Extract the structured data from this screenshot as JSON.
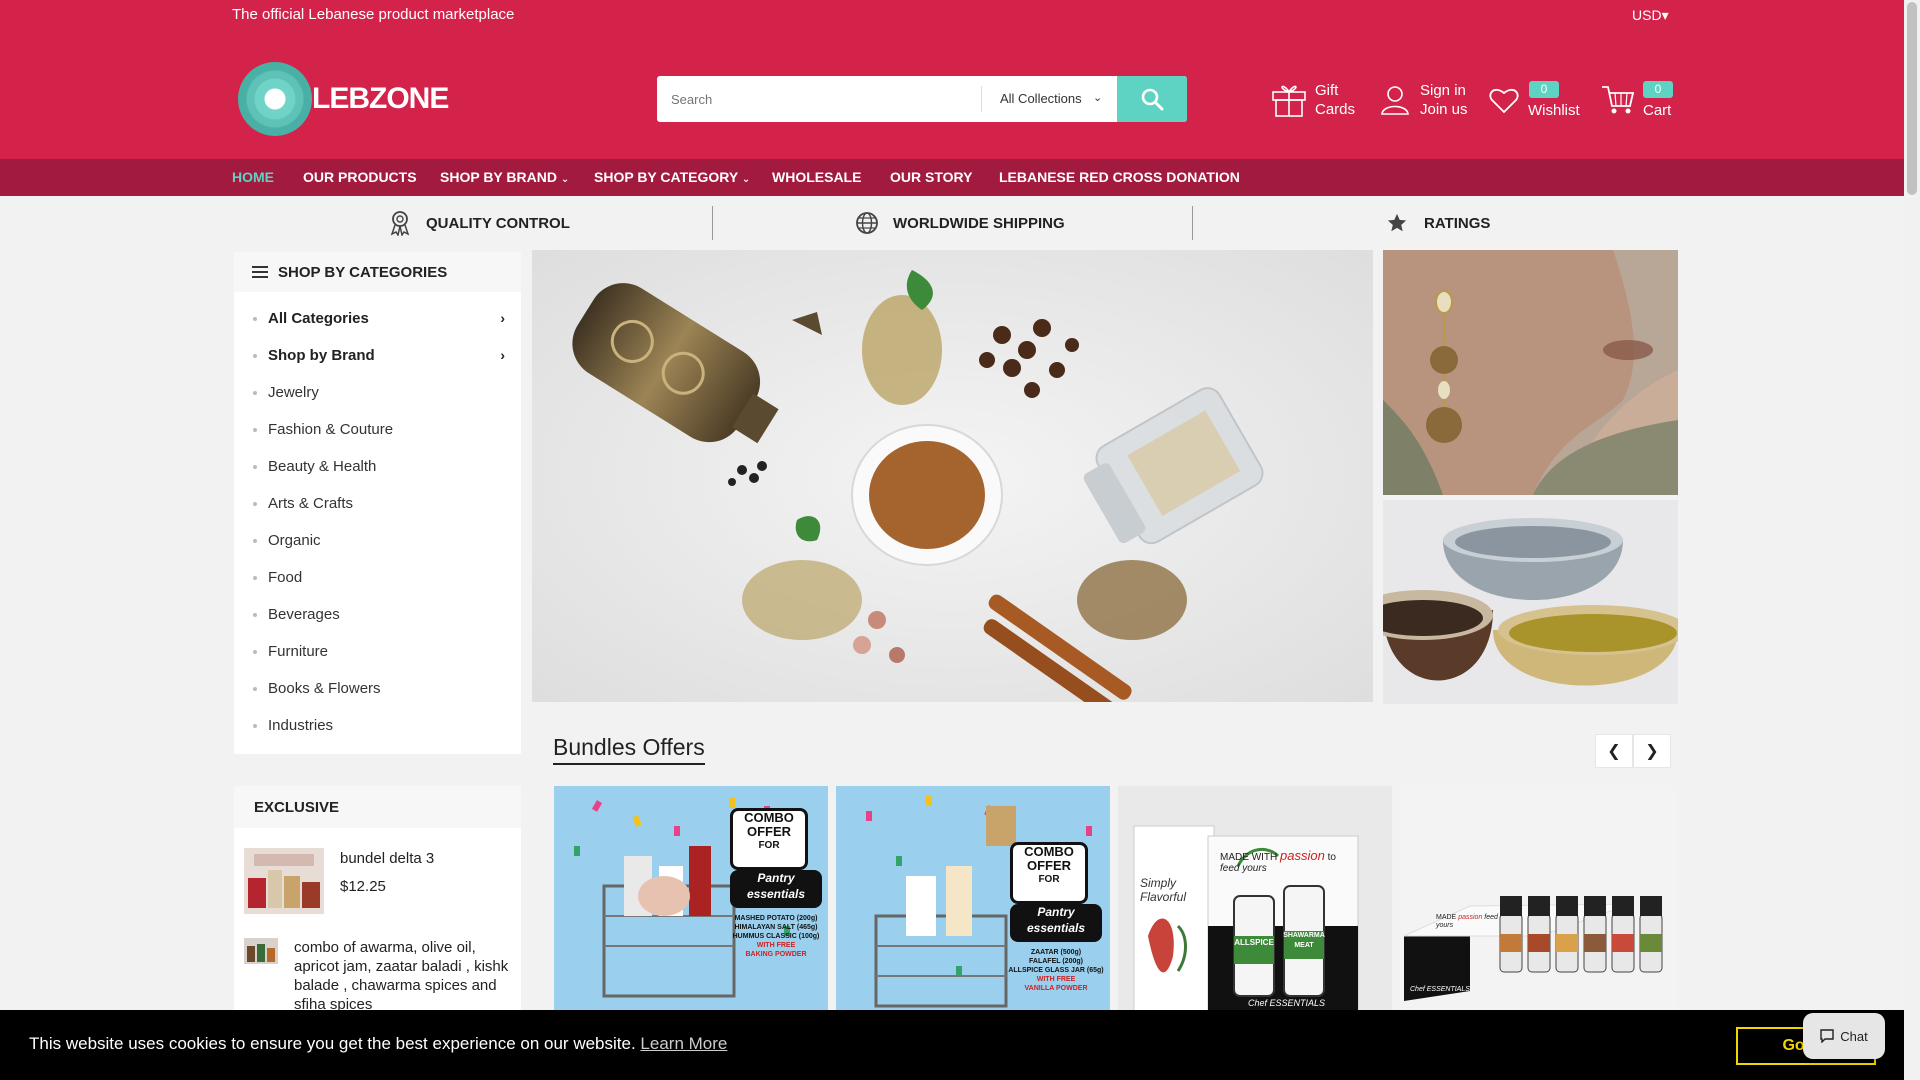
{
  "header": {
    "tagline": "The official Lebanese product marketplace",
    "currency": "USD",
    "logo_text": "LEBZONE",
    "search": {
      "placeholder": "Search",
      "collection": "All Collections"
    },
    "gift_cards": {
      "line1": "Gift",
      "line2": "Cards"
    },
    "account": {
      "line1": "Sign in",
      "line2": "Join us"
    },
    "wishlist": {
      "count": "0",
      "label": "Wishlist"
    },
    "cart": {
      "count": "0",
      "label": "Cart"
    },
    "accent_color": "#5fd3c3",
    "brand_color": "#d4234a"
  },
  "nav": {
    "items": [
      {
        "label": "HOME"
      },
      {
        "label": "OUR PRODUCTS"
      },
      {
        "label": "SHOP BY BRAND"
      },
      {
        "label": "SHOP BY CATEGORY"
      },
      {
        "label": "WHOLESALE"
      },
      {
        "label": "OUR STORY"
      },
      {
        "label": "LEBANESE RED CROSS DONATION"
      }
    ]
  },
  "features": [
    {
      "label": "QUALITY CONTROL",
      "icon": "award-icon"
    },
    {
      "label": "WORLDWIDE SHIPPING",
      "icon": "globe-icon"
    },
    {
      "label": "RATINGS",
      "icon": "star-icon"
    }
  ],
  "sidebar": {
    "title": "SHOP BY CATEGORIES",
    "categories": [
      {
        "label": "All Categories"
      },
      {
        "label": "Shop by Brand"
      },
      {
        "label": "Jewelry"
      },
      {
        "label": "Fashion & Couture"
      },
      {
        "label": "Beauty & Health"
      },
      {
        "label": "Arts & Crafts"
      },
      {
        "label": "Organic"
      },
      {
        "label": "Food"
      },
      {
        "label": "Beverages"
      },
      {
        "label": "Furniture"
      },
      {
        "label": "Books & Flowers"
      },
      {
        "label": "Industries"
      }
    ]
  },
  "exclusive": {
    "title": "EXCLUSIVE",
    "items": [
      {
        "name": "bundel delta 3",
        "price": "$12.25"
      },
      {
        "name": "combo of awarma, olive oil, apricot jam, zaatar baladi , kishk balade , chawarma spices and sfiha spices"
      }
    ]
  },
  "bundles": {
    "title": "Bundles Offers",
    "products": [
      {
        "badge": [
          "COMBO",
          "OFFER",
          "FOR",
          "Pantry",
          "essentials"
        ],
        "items": [
          "MASHED POTATO (200g)",
          "HIMALAYAN SALT (465g)",
          "HUMMUS CLASSIC (100g)",
          "WITH FREE",
          "BAKING POWDER"
        ]
      },
      {
        "badge": [
          "COMBO",
          "OFFER",
          "FOR",
          "Pantry",
          "essentials"
        ],
        "items": [
          "ZAATAR (500g)",
          "FALAFEL (200g)",
          "ALLSPICE GLASS JAR (65g)",
          "WITH FREE",
          "VANILLA POWDER"
        ]
      },
      {
        "box_text": [
          "Simply",
          "Flavorful"
        ],
        "tagline": [
          "MADE",
          "WITH",
          "passion",
          "to",
          "feed yours"
        ],
        "jar_labels": [
          "ALLSPICE",
          "SHAWARMA",
          "MEAT"
        ],
        "brand": "Chef ESSENTIALS"
      },
      {
        "box_text": [
          "MADE",
          "passion",
          "feed yours"
        ],
        "brand": "Chef ESSENTIALS"
      }
    ]
  },
  "cookie": {
    "message": "This website uses cookies to ensure you get the best experience on our website.",
    "learn_more": "Learn More",
    "button": "Got it!"
  },
  "chat": {
    "label": "Chat"
  }
}
